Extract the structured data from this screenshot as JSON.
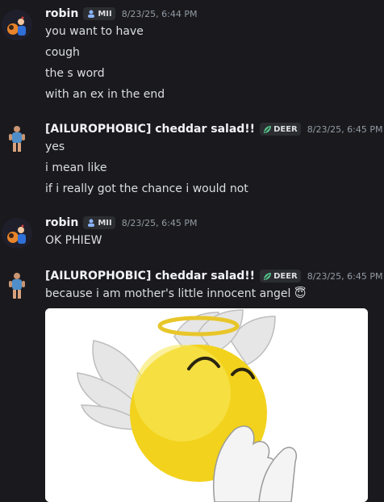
{
  "messages": [
    {
      "author": "robin",
      "tag": "MII",
      "timestamp": "8/23/25, 6:44 PM",
      "lines": [
        "you want to have",
        "cough",
        "the s word",
        "with an ex in the end"
      ]
    },
    {
      "author": "[AILUROPHOBIC] cheddar salad!!",
      "tag": "DEER",
      "timestamp": "8/23/25, 6:45 PM",
      "lines": [
        "yes",
        "i mean like",
        "if i really got the chance i would not"
      ]
    },
    {
      "author": "robin",
      "tag": "MII",
      "timestamp": "8/23/25, 6:45 PM",
      "lines": [
        "OK PHIEW"
      ]
    },
    {
      "author": "[AILUROPHOBIC] cheddar salad!!",
      "tag": "DEER",
      "timestamp": "8/23/25, 6:45 PM",
      "lines": [
        "because i am mother's little innocent angel"
      ],
      "emoji": "😇"
    }
  ],
  "icons": {
    "mii_tag": "mii-icon",
    "deer_tag": "leaf-icon",
    "attachment": "angel-emoji-gif"
  },
  "colors": {
    "background": "#1a1a1e",
    "text": "#dbdee1",
    "timestamp": "#949ba4",
    "tag_bg": "#2b2d31",
    "deer_leaf": "#57c08a"
  }
}
